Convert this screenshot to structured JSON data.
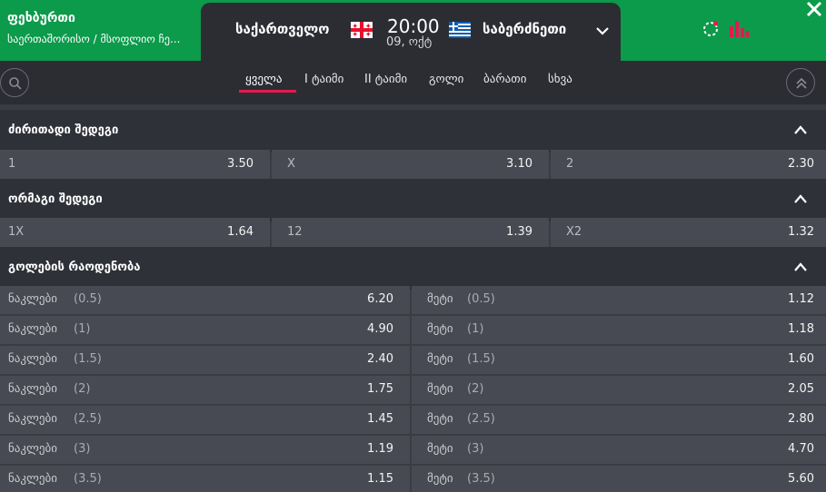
{
  "header": {
    "sport": "ფეხბურთი",
    "league": "საერთაშორისო / მსოფლიო ჩე...",
    "home_team": "საქართველო",
    "away_team": "საბერძნეთი",
    "time": "20:00",
    "date": "09, ოქტ",
    "icons": [
      "georgia-flag",
      "greece-flag",
      "chevron-down-icon",
      "live-icon",
      "stats-icon",
      "close-icon"
    ],
    "colors": {
      "header_bg": "#0c9a4b",
      "accent": "#e6194f",
      "stats_icon": "#e6194f"
    }
  },
  "tabs": [
    {
      "label": "ყველა",
      "active": true
    },
    {
      "label": "I ტაიმი",
      "active": false
    },
    {
      "label": "II ტაიმი",
      "active": false
    },
    {
      "label": "გოლი",
      "active": false
    },
    {
      "label": "ბარათი",
      "active": false
    },
    {
      "label": "სხვა",
      "active": false
    }
  ],
  "sections": {
    "main_result": {
      "title": "ძირითადი შედეგი",
      "odds": [
        {
          "label": "1",
          "value": "3.50"
        },
        {
          "label": "X",
          "value": "3.10"
        },
        {
          "label": "2",
          "value": "2.30"
        }
      ]
    },
    "double_chance": {
      "title": "ორმაგი შედეგი",
      "odds": [
        {
          "label": "1X",
          "value": "1.64"
        },
        {
          "label": "12",
          "value": "1.39"
        },
        {
          "label": "X2",
          "value": "1.32"
        }
      ]
    },
    "total_goals": {
      "title": "გოლების რაოდენობა",
      "under_label": "ნაკლები",
      "over_label": "მეტი",
      "rows": [
        {
          "line": "(0.5)",
          "under": "6.20",
          "over": "1.12"
        },
        {
          "line": "(1)",
          "under": "4.90",
          "over": "1.18"
        },
        {
          "line": "(1.5)",
          "under": "2.40",
          "over": "1.60"
        },
        {
          "line": "(2)",
          "under": "1.75",
          "over": "2.05"
        },
        {
          "line": "(2.5)",
          "under": "1.45",
          "over": "2.80"
        },
        {
          "line": "(3)",
          "under": "1.19",
          "over": "4.70"
        },
        {
          "line": "(3.5)",
          "under": "1.15",
          "over": "5.60"
        }
      ]
    }
  }
}
